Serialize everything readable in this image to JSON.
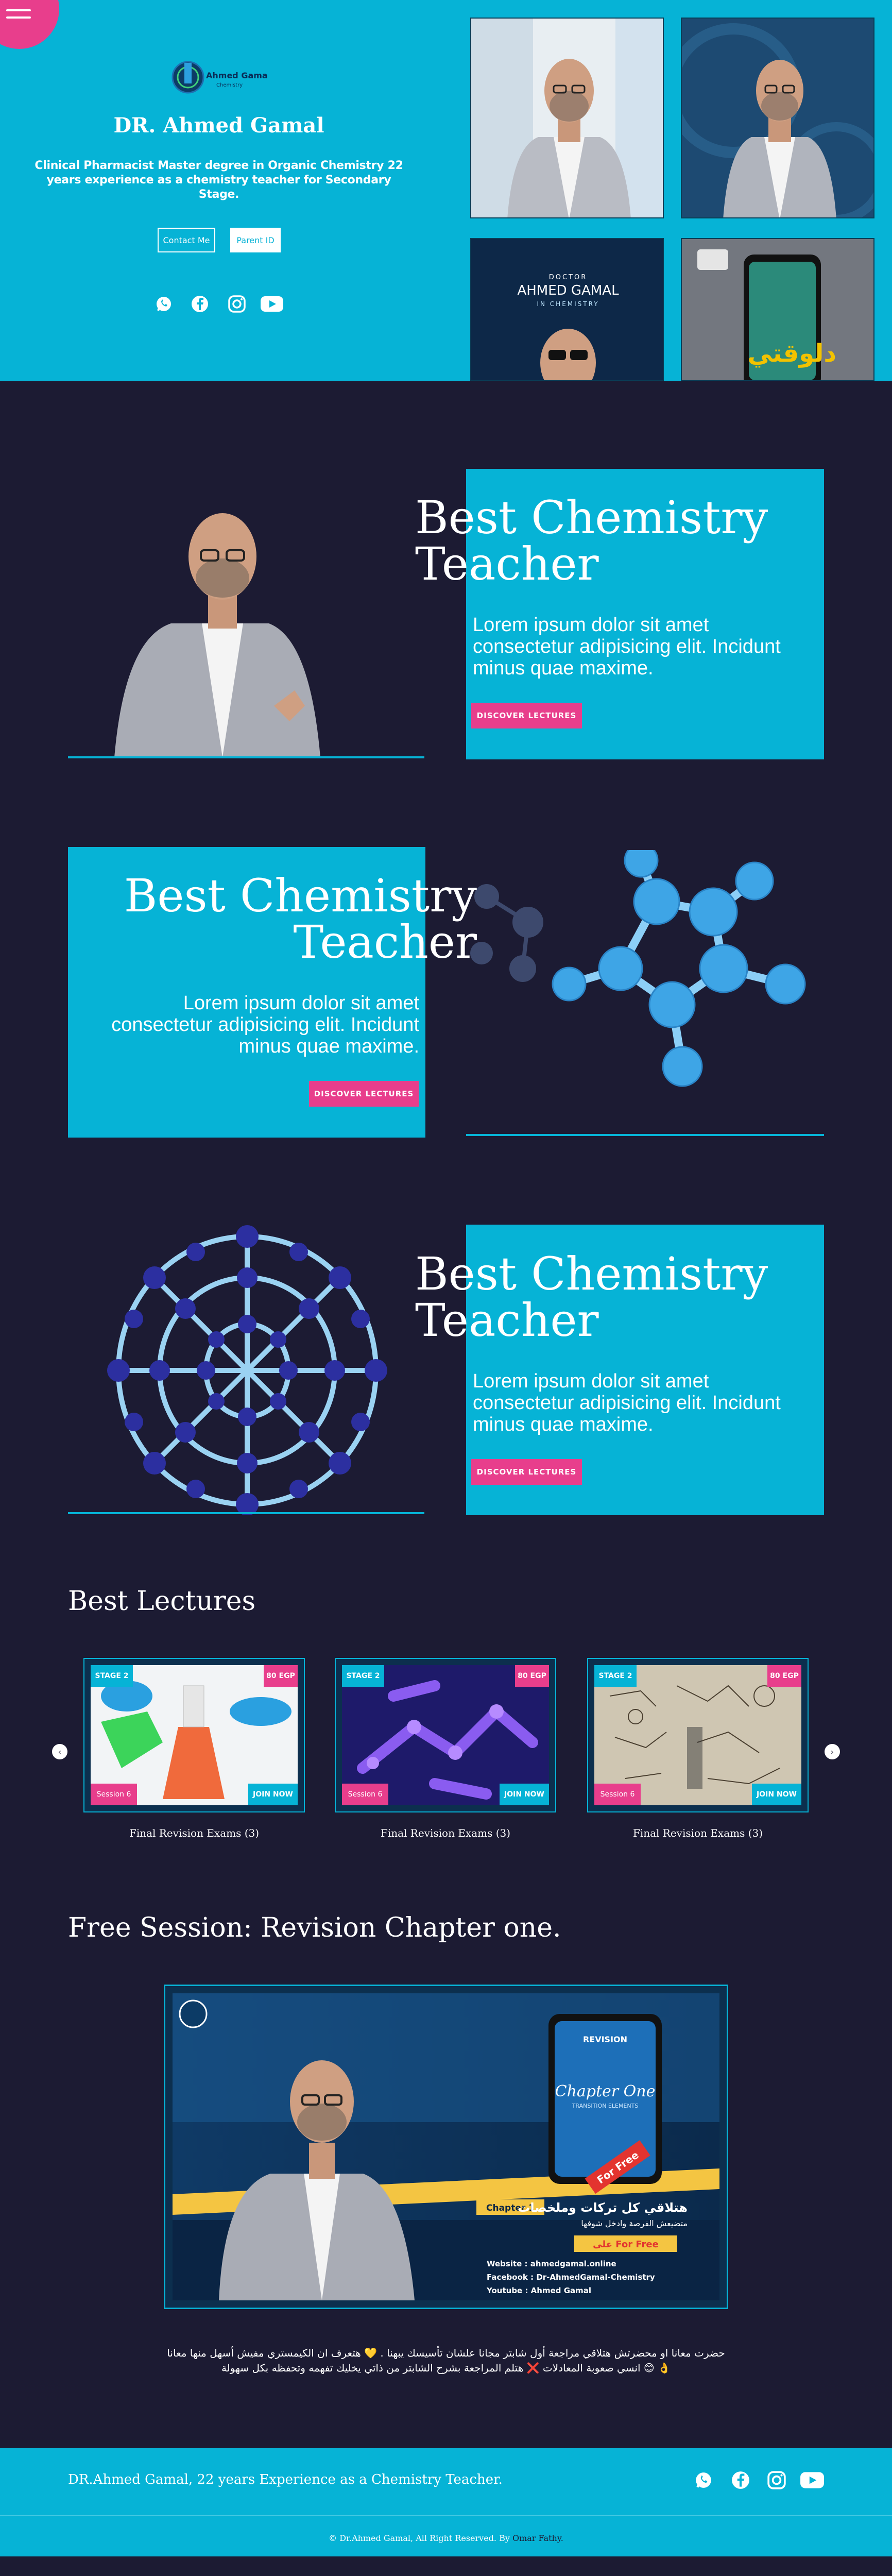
{
  "hero": {
    "logo_text": "Ahmed Gamal",
    "logo_sub": "Chemistry",
    "title": "DR. Ahmed Gamal",
    "subtitle": "Clinical Pharmacist Master degree in Organic Chemistry 22 years experience as a chemistry teacher for Secondary Stage.",
    "contact_label": "Contact Me",
    "parent_label": "Parent ID",
    "thumb3_line1": "DOCTOR",
    "thumb3_line2": "AHMED GAMAL",
    "thumb3_line3": "IN CHEMISTRY",
    "thumb4_text": "دلوقتي"
  },
  "features": [
    {
      "title": "Best Chemistry Teacher",
      "text": "Lorem ipsum dolor sit amet consectetur adipisicing elit. Incidunt minus quae maxime.",
      "button": "DISCOVER LECTURES"
    },
    {
      "title": "Best Chemistry Teacher",
      "text": "Lorem ipsum dolor sit amet consectetur adipisicing elit. Incidunt minus quae maxime.",
      "button": "DISCOVER LECTURES"
    },
    {
      "title": "Best Chemistry Teacher",
      "text": "Lorem ipsum dolor sit amet consectetur adipisicing elit. Incidunt minus quae maxime.",
      "button": "DISCOVER LECTURES"
    }
  ],
  "lectures": {
    "heading": "Best Lectures",
    "items": [
      {
        "stage": "STAGE 2",
        "price": "80 EGP",
        "session": "Session 6",
        "join": "JOIN NOW",
        "caption": "Final Revision Exams (3)"
      },
      {
        "stage": "STAGE 2",
        "price": "80 EGP",
        "session": "Session 6",
        "join": "JOIN NOW",
        "caption": "Final Revision Exams (3)"
      },
      {
        "stage": "STAGE 2",
        "price": "80 EGP",
        "session": "Session 6",
        "join": "JOIN NOW",
        "caption": "Final Revision Exams (3)"
      }
    ],
    "prev": "‹",
    "next": "›"
  },
  "free_session": {
    "heading": "Free Session: Revision Chapter one.",
    "poster_revision": "REVISION",
    "poster_chapter": "Chapter One",
    "poster_transition": "TRANSITION ELEMENTS",
    "poster_forfree": "For Free",
    "poster_chapter_tag": "Chapter 1",
    "poster_arabic1": "هتلاقي كل تركات وملخصات",
    "poster_arabic2": "متضيعش الفرصة وادخل شوفها",
    "poster_free_arabic": "على For Free",
    "poster_website": "Website : ahmedgamal.online",
    "poster_facebook": "Facebook : Dr-AhmedGamal-Chemistry",
    "poster_youtube": "Youtube : Ahmed Gamal",
    "desc_line1": "حضرت معانا او محضرتش هتلاقي مراجعة أول شابتر مجانا علشان تأسيسك يبهنا . 💛 هتعرف ان الكيمستري مفيش أسهل منها معانا",
    "desc_line2": "👌 😊 انسي صعوبة المعادلات ❌ هتلم المراجعة بشرح الشابتر من ذاتي يخليك تفهمه وتحفظه بكل سهولة"
  },
  "footer": {
    "tagline": "DR.Ahmed Gamal, 22 years Experience as a Chemistry Teacher.",
    "copyright_prefix": "© Dr.Ahmed Gamal, All Right Reserved. By",
    "copyright_author": "Omar Fathy."
  },
  "colors": {
    "cyan": "#06b3d6",
    "navy": "#1c1b33",
    "pink": "#e83e8c"
  }
}
